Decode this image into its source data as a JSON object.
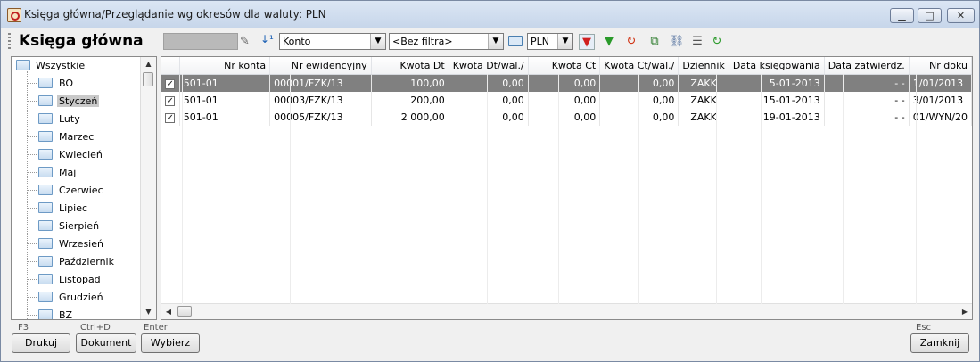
{
  "window": {
    "title": "Księga główna/Przeglądanie wg okresów dla waluty: PLN"
  },
  "toolbar": {
    "main_title": "Księga główna",
    "sort_field": "Konto",
    "filter": "<Bez filtra>",
    "currency": "PLN"
  },
  "tree": {
    "root": "Wszystkie",
    "items": [
      "BO",
      "Styczeń",
      "Luty",
      "Marzec",
      "Kwiecień",
      "Maj",
      "Czerwiec",
      "Lipiec",
      "Sierpień",
      "Wrzesień",
      "Październik",
      "Listopad",
      "Grudzień",
      "BZ"
    ],
    "selected": "Styczeń"
  },
  "grid": {
    "columns": [
      "Nr konta",
      "Nr ewidencyjny",
      "Kwota Dt",
      "Kwota Dt/wal./",
      "Kwota Ct",
      "Kwota Ct/wal./",
      "Dziennik",
      "Data księgowania",
      "Data zatwierdz.",
      "Nr doku"
    ],
    "rows": [
      {
        "checked": true,
        "selected": true,
        "cells": [
          "501-01",
          "00001/FZK/13",
          "100,00",
          "0,00",
          "0,00",
          "0,00",
          "ZAKK",
          "5-01-2013",
          "- -",
          "1/01/2013"
        ]
      },
      {
        "checked": true,
        "selected": false,
        "cells": [
          "501-01",
          "00003/FZK/13",
          "200,00",
          "0,00",
          "0,00",
          "0,00",
          "ZAKK",
          "15-01-2013",
          "- -",
          "3/01/2013"
        ]
      },
      {
        "checked": true,
        "selected": false,
        "cells": [
          "501-01",
          "00005/FZK/13",
          "2 000,00",
          "0,00",
          "0,00",
          "0,00",
          "ZAKK",
          "19-01-2013",
          "- -",
          "01/WYN/20"
        ]
      }
    ]
  },
  "buttons": {
    "print": "Drukuj",
    "document": "Dokument",
    "select": "Wybierz",
    "close": "Zamknij"
  },
  "hotkeys": {
    "print": "F3",
    "document": "Ctrl+D",
    "select": "Enter",
    "close": "Esc"
  },
  "icons": {
    "app": "accounting-book-icon",
    "pencil": "pencil-icon",
    "sort": "sort-icon",
    "folder": "folder-icon",
    "filter_red": "filter-icon",
    "filter_green": "filter-add-icon",
    "refresh_red": "refresh-icon",
    "export": "export-icon",
    "link": "link-icon",
    "grid": "grid-layout-icon",
    "refresh_green": "reload-icon"
  }
}
